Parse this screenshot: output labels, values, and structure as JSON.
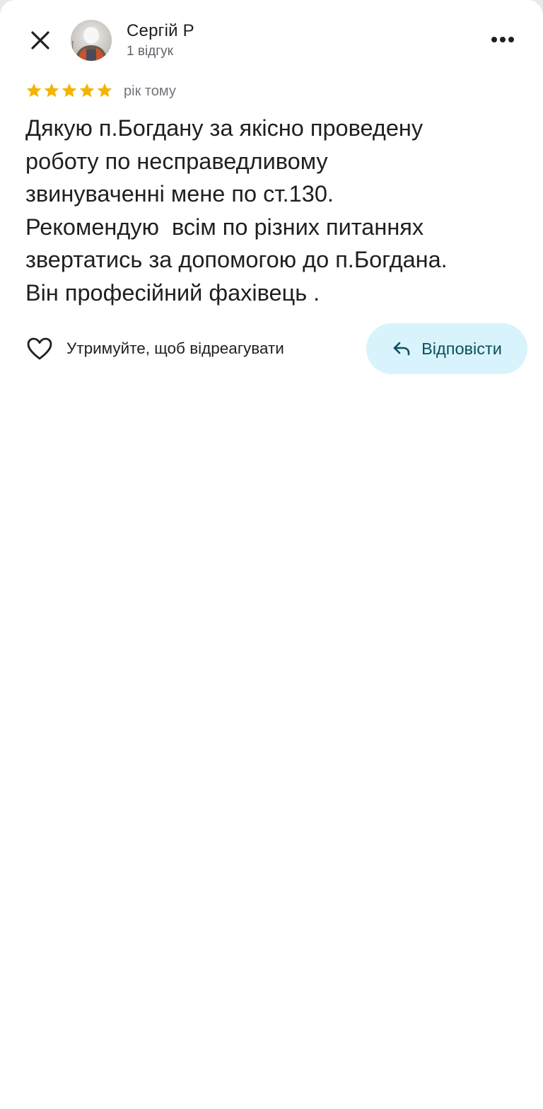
{
  "header": {
    "close_icon": "close-icon",
    "author_name": "Сергій Р",
    "review_count": "1 відгук",
    "more_icon": "more-horizontal-icon"
  },
  "review": {
    "rating": 5,
    "rating_max": 5,
    "star_color": "#f4b400",
    "age": "рік тому",
    "text": "Дякую п.Богдану за якісно проведену\nроботу по несправедливому\nзвинуваченні мене по ст.130.\nРекомендую  всім по різних питаннях\nзвертатись за допомогою до п.Богдана.\nВін професійний фахівець ."
  },
  "actions": {
    "react_icon": "heart-outline-icon",
    "react_label": "Утримуйте, щоб відреагувати",
    "reply_icon": "reply-arrow-icon",
    "reply_label": "Відповісти",
    "reply_bg": "#d8f3fb",
    "reply_text_color": "#0b4f5c"
  }
}
